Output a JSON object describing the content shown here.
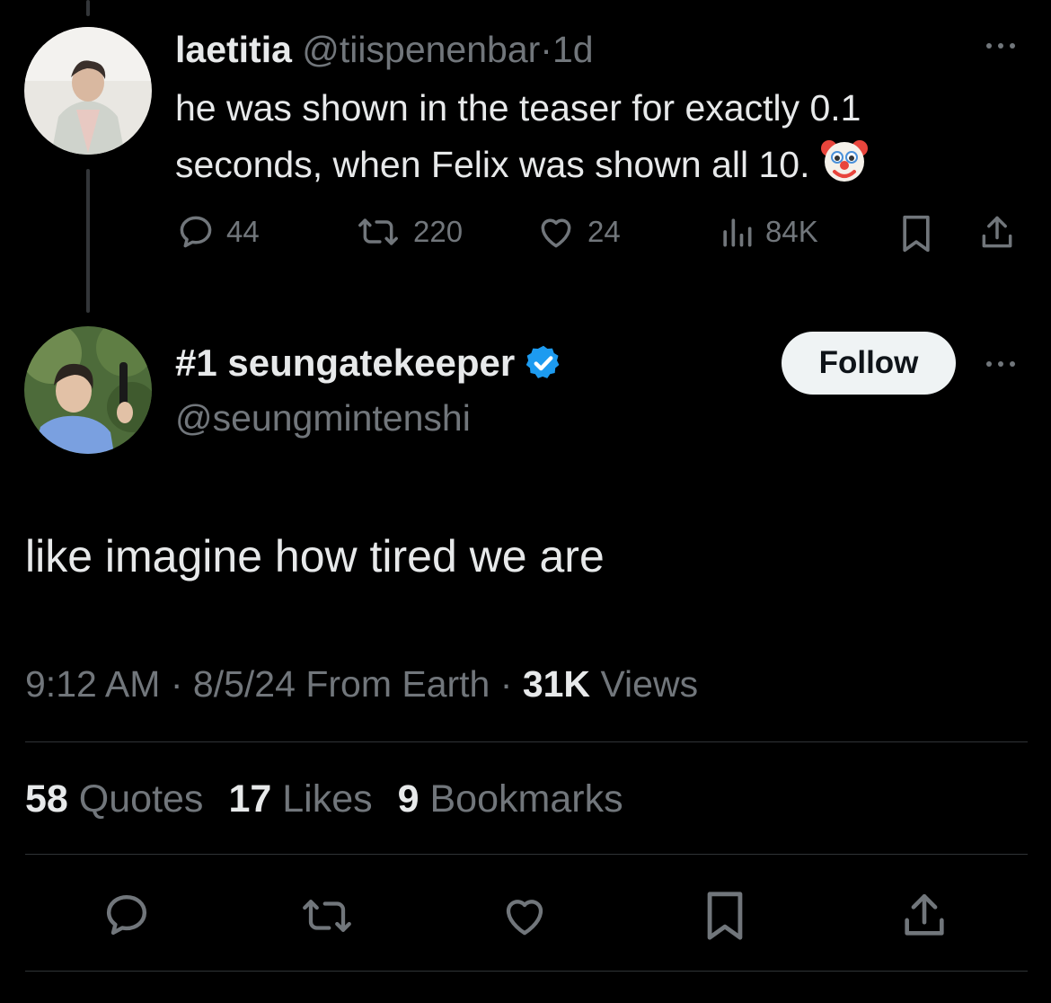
{
  "reply_tweet": {
    "display_name": "laetitia",
    "handle": "@tiispenenbar",
    "separator": "·",
    "time_ago": "1d",
    "text": "he was shown in the teaser for exactly 0.1 seconds, when Felix was shown all 10.",
    "emoji_icon": "clown-face-icon",
    "actions": {
      "replies": "44",
      "retweets": "220",
      "likes": "24",
      "views": "84K"
    }
  },
  "main_tweet": {
    "display_name": "#1 seungatekeeper",
    "verified_icon": "verified-badge-icon",
    "handle": "@seungmintenshi",
    "follow_label": "Follow",
    "text": "like imagine how tired we are",
    "meta": {
      "time": "9:12 AM",
      "sep1": "·",
      "date": "8/5/24",
      "source": "From Earth",
      "sep2": "·",
      "views_count": "31K",
      "views_label": "Views"
    },
    "stats": {
      "quotes_count": "58",
      "quotes_label": "Quotes",
      "likes_count": "17",
      "likes_label": "Likes",
      "bookmarks_count": "9",
      "bookmarks_label": "Bookmarks"
    }
  },
  "colors": {
    "background": "#000000",
    "text_primary": "#e7e9ea",
    "text_secondary": "#71767b",
    "verified": "#1d9bf0",
    "follow_bg": "#eff3f4",
    "divider": "#2f3336"
  }
}
